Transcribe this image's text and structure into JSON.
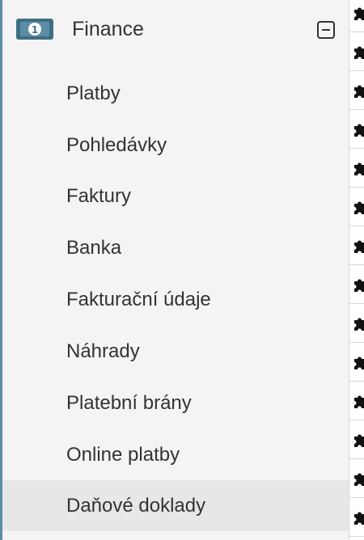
{
  "section": {
    "title": "Finance",
    "icon": "banknote-icon",
    "toggle_icon": "collapse-minus-icon",
    "accent_color": "#5b8ea6"
  },
  "nav_items": [
    {
      "label": "Platby"
    },
    {
      "label": "Pohledávky"
    },
    {
      "label": "Faktury"
    },
    {
      "label": "Banka"
    },
    {
      "label": "Fakturační údaje"
    },
    {
      "label": "Náhrady"
    },
    {
      "label": "Platební brány"
    },
    {
      "label": "Online platby"
    },
    {
      "label": "Daňové doklady",
      "active": true
    }
  ],
  "right_strip": {
    "icon": "puzzle-piece-icon"
  }
}
